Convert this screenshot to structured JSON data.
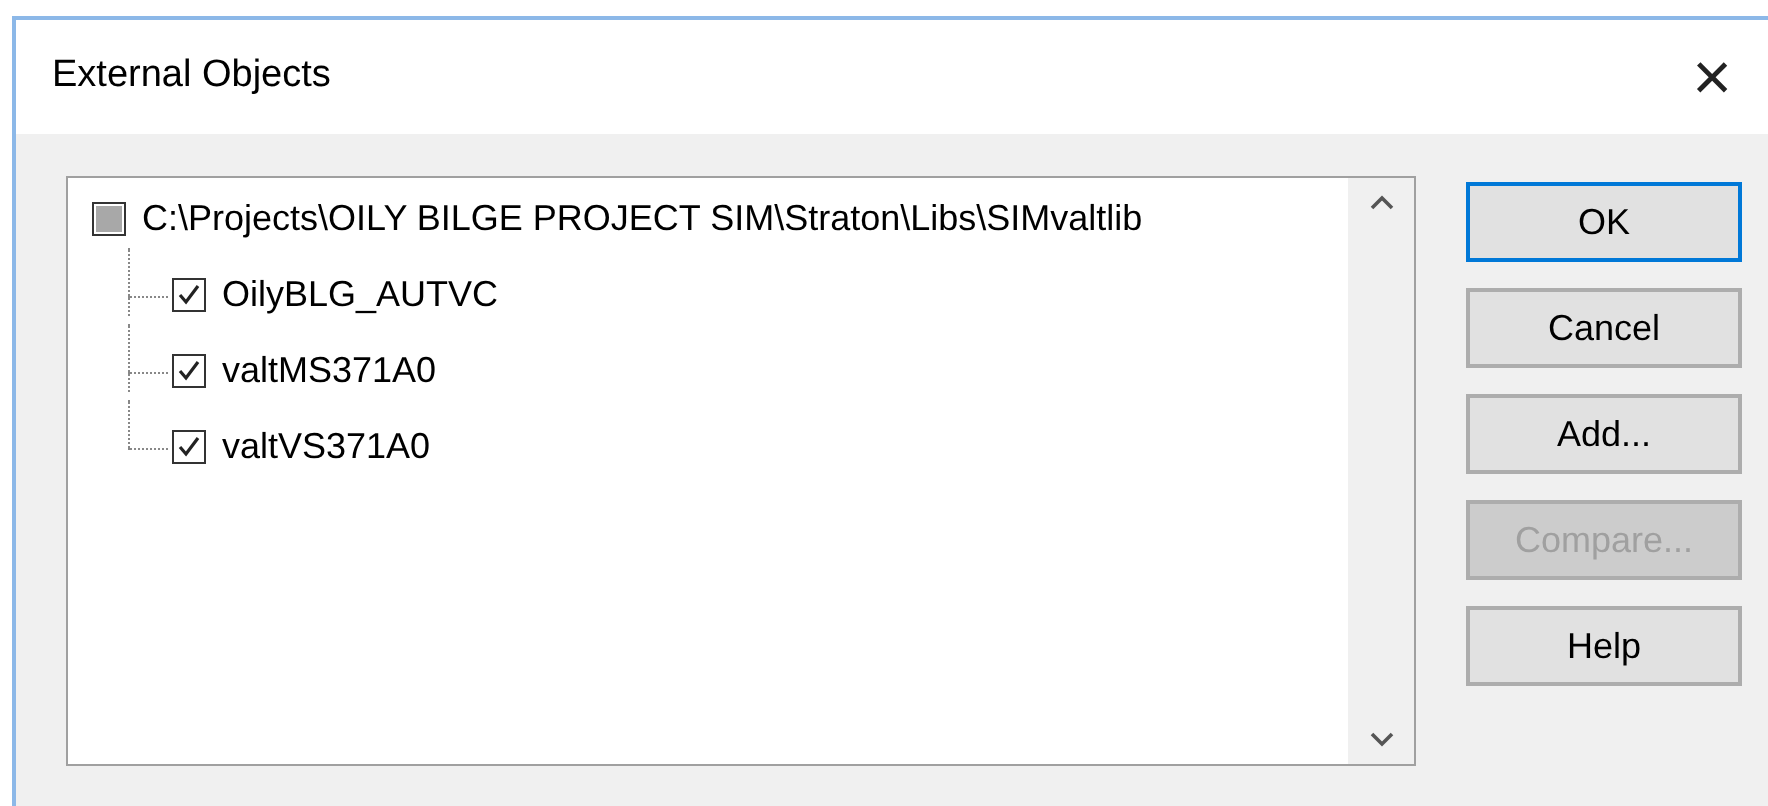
{
  "window": {
    "title": "External Objects",
    "close": "×"
  },
  "tree": {
    "root": {
      "label": "C:\\Projects\\OILY BILGE PROJECT SIM\\Straton\\Libs\\SIMvaltlib",
      "mixed": true,
      "children": [
        {
          "label": "OilyBLG_AUTVC",
          "checked": true
        },
        {
          "label": "valtMS371A0",
          "checked": true
        },
        {
          "label": "valtVS371A0",
          "checked": true
        }
      ]
    }
  },
  "buttons": [
    {
      "label": "OK",
      "default": true,
      "disabled": false
    },
    {
      "label": "Cancel",
      "default": false,
      "disabled": false
    },
    {
      "label": "Add...",
      "default": false,
      "disabled": false
    },
    {
      "label": "Compare...",
      "default": false,
      "disabled": true
    },
    {
      "label": "Help",
      "default": false,
      "disabled": false
    }
  ]
}
